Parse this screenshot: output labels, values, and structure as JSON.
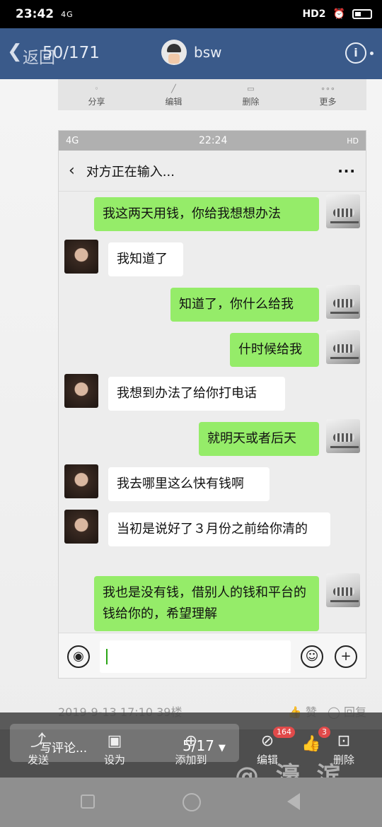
{
  "status_bar": {
    "time": "23:42",
    "network": "4G",
    "hd": "HD2"
  },
  "nav": {
    "back_label": "返回",
    "counter": "50/171",
    "username": "bsw",
    "info_glyph": "i"
  },
  "actions": [
    {
      "label": "分享",
      "icon": "share-icon"
    },
    {
      "label": "编辑",
      "icon": "edit-icon"
    },
    {
      "label": "删除",
      "icon": "trash-icon"
    },
    {
      "label": "更多",
      "icon": "more-icon"
    }
  ],
  "chat": {
    "status_time": "22:24",
    "status_net": "4G",
    "status_right": "HD",
    "title": "对方正在输入...",
    "messages": [
      {
        "from": "me",
        "text": "我这两天用钱，你给我想想办法"
      },
      {
        "from": "them",
        "text": "我知道了"
      },
      {
        "from": "me",
        "text": "知道了，你什么给我"
      },
      {
        "from": "me",
        "text": "什时候给我"
      },
      {
        "from": "them",
        "text": "我想到办法了给你打电话"
      },
      {
        "from": "me",
        "text": "就明天或者后天"
      },
      {
        "from": "them",
        "text": "我去哪里这么快有钱啊"
      },
      {
        "from": "them",
        "text": "当初是说好了３月份之前给你清的"
      },
      {
        "from": "me",
        "text": "我也是没有钱，借别人的钱和平台的钱给你的，希望理解"
      }
    ]
  },
  "post_meta": {
    "date": "2019-9-13 17:10 39楼",
    "like": "赞",
    "reply": "回复"
  },
  "bottom": {
    "comment_placeholder": "写评论...",
    "page_indicator": "5/17",
    "tools": [
      {
        "label": "发送",
        "icon": "send-icon"
      },
      {
        "label": "设为",
        "icon": "image-icon"
      },
      {
        "label": "添加到",
        "icon": "add-icon"
      },
      {
        "label": "编辑",
        "icon": "edit-icon"
      },
      {
        "label": "删除",
        "icon": "trash-icon"
      }
    ],
    "badge_edit": "164",
    "badge_like": "3"
  },
  "watermark": "@ 濠 滨"
}
